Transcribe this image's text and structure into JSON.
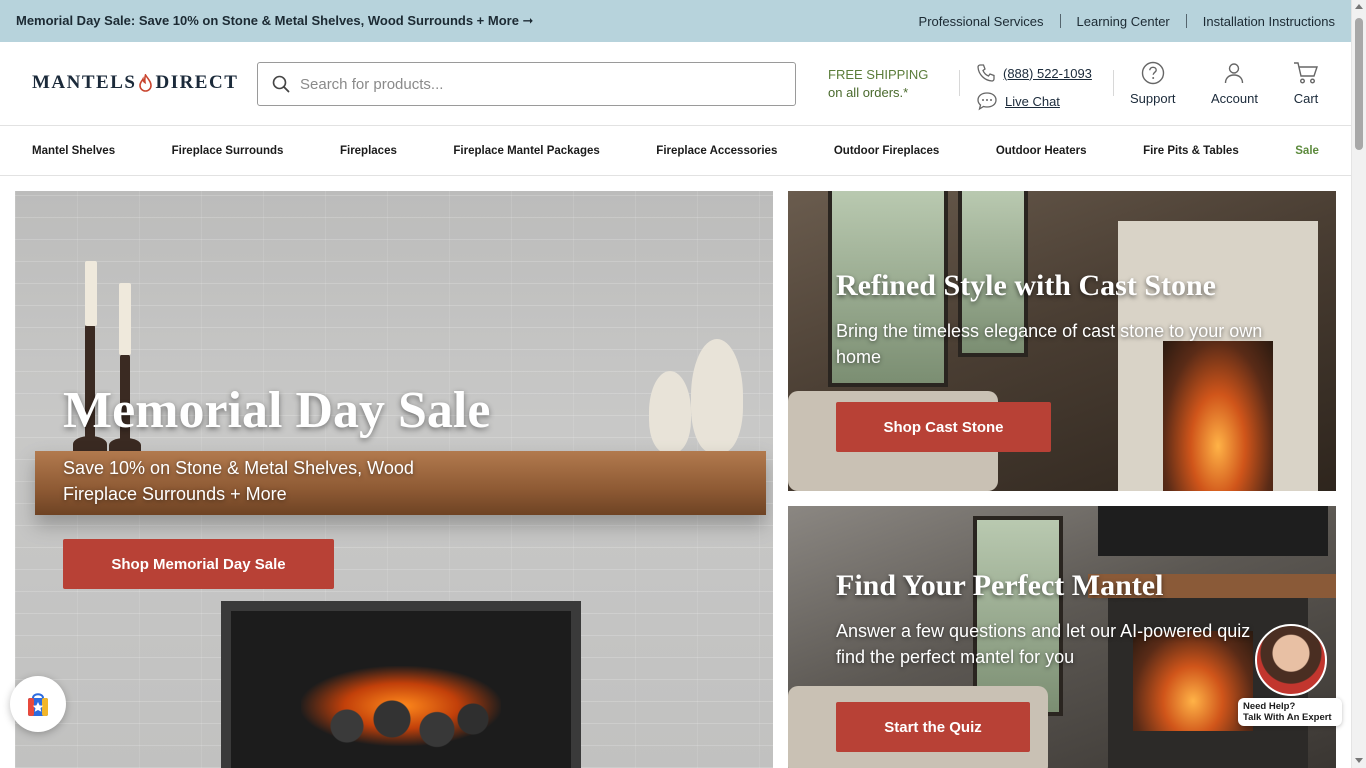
{
  "promo": {
    "text": "Memorial Day Sale: Save 10% on Stone & Metal Shelves, Wood Surrounds + More ➞",
    "links": [
      "Professional Services",
      "Learning Center",
      "Installation Instructions"
    ]
  },
  "header": {
    "logo": {
      "left": "MANTELS",
      "right": "DIRECT"
    },
    "search_placeholder": "Search for products...",
    "shipping": {
      "line1": "FREE SHIPPING",
      "line2": "on all orders.*"
    },
    "phone": "(888) 522-1093",
    "chat": "Live Chat",
    "support": "Support",
    "account": "Account",
    "cart": "Cart"
  },
  "nav": {
    "items": [
      "Mantel Shelves",
      "Fireplace Surrounds",
      "Fireplaces",
      "Fireplace Mantel Packages",
      "Fireplace Accessories",
      "Outdoor Fireplaces",
      "Outdoor Heaters",
      "Fire Pits & Tables",
      "Sale"
    ]
  },
  "hero": {
    "title": "Memorial Day Sale",
    "subtitle": "Save 10% on Stone & Metal Shelves, Wood Fireplace Surrounds + More",
    "button": "Shop Memorial Day Sale"
  },
  "cards": [
    {
      "title": "Refined Style with Cast Stone",
      "subtitle": "Bring the timeless elegance of cast stone to your own home",
      "button": "Shop Cast Stone"
    },
    {
      "title": "Find Your Perfect Mantel",
      "subtitle": "Answer a few questions and let our AI-powered quiz find the perfect mantel for you",
      "button": "Start the Quiz"
    }
  ],
  "expert": {
    "line1": "Need Help?",
    "line2": "Talk With An Expert"
  },
  "colors": {
    "promo_bg": "#b7d3dc",
    "accent_button": "#b84136",
    "sale_link": "#5c8a3c",
    "shipping_text": "#5b7d3a"
  },
  "icons": [
    "search-icon",
    "phone-icon",
    "chat-icon",
    "support-icon",
    "account-icon",
    "cart-icon",
    "flame-icon",
    "rewards-icon"
  ]
}
